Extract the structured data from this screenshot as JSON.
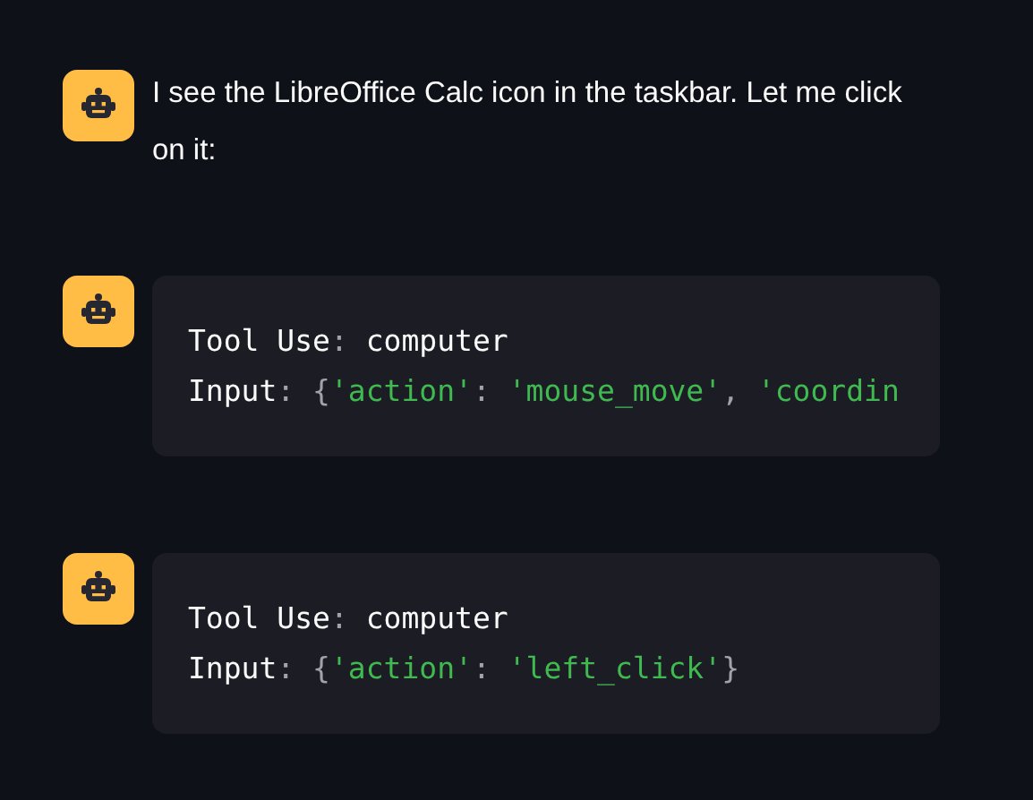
{
  "messages": [
    {
      "kind": "text",
      "text": "I see the LibreOffice Calc icon in the taskbar. Let me click on it:"
    },
    {
      "kind": "code",
      "lines": [
        [
          {
            "kind": "plain",
            "text": "Tool Use"
          },
          {
            "kind": "punct",
            "text": ":"
          },
          {
            "kind": "plain",
            "text": " computer"
          }
        ],
        [
          {
            "kind": "plain",
            "text": "Input"
          },
          {
            "kind": "punct",
            "text": ": {"
          },
          {
            "kind": "string",
            "text": "'action'"
          },
          {
            "kind": "punct",
            "text": ": "
          },
          {
            "kind": "string",
            "text": "'mouse_move'"
          },
          {
            "kind": "punct",
            "text": ", "
          },
          {
            "kind": "string",
            "text": "'coordin"
          }
        ]
      ]
    },
    {
      "kind": "code",
      "lines": [
        [
          {
            "kind": "plain",
            "text": "Tool Use"
          },
          {
            "kind": "punct",
            "text": ":"
          },
          {
            "kind": "plain",
            "text": " computer"
          }
        ],
        [
          {
            "kind": "plain",
            "text": "Input"
          },
          {
            "kind": "punct",
            "text": ": {"
          },
          {
            "kind": "string",
            "text": "'action'"
          },
          {
            "kind": "punct",
            "text": ": "
          },
          {
            "kind": "string",
            "text": "'left_click'"
          },
          {
            "kind": "punct",
            "text": "}"
          }
        ]
      ]
    }
  ]
}
